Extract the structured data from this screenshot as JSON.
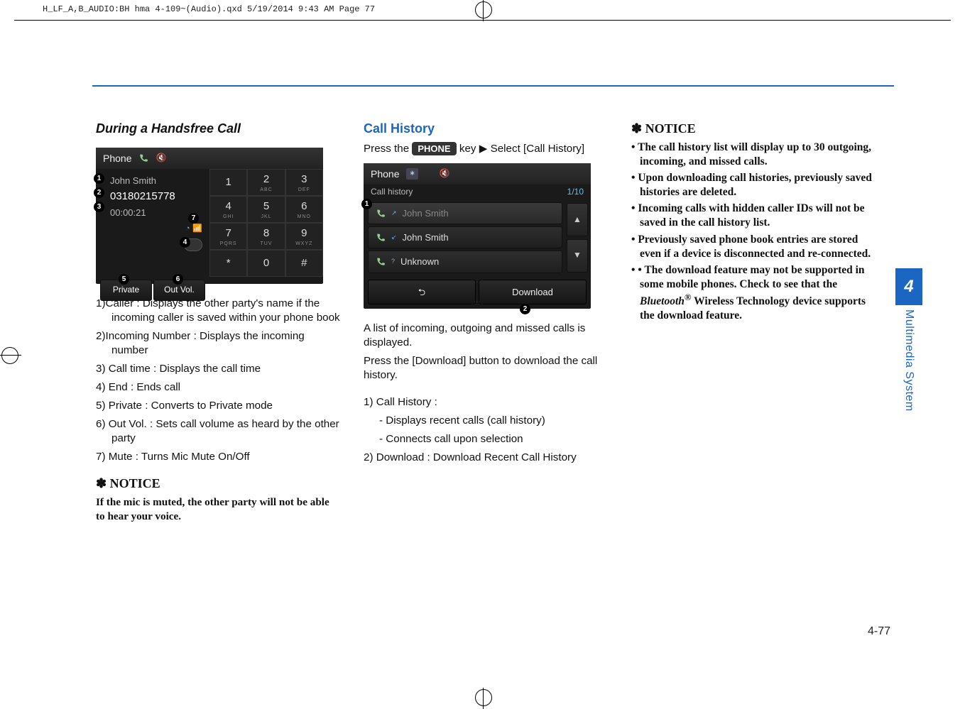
{
  "print_header": "H_LF_A,B_AUDIO:BH hma 4-109~(Audio).qxd  5/19/2014  9:43 AM  Page 77",
  "side_tab": {
    "chapter": "4",
    "label": "Multimedia System"
  },
  "page_number": "4-77",
  "col1": {
    "heading": "During a Handsfree Call",
    "ss": {
      "title": "Phone",
      "caller_name": "John Smith",
      "incoming_number": "03180215778",
      "call_time": "00:00:21",
      "btn_private": "Private",
      "btn_outvol": "Out Vol.",
      "keys": [
        {
          "n": "1",
          "s": ""
        },
        {
          "n": "2",
          "s": "ABC"
        },
        {
          "n": "3",
          "s": "DEF"
        },
        {
          "n": "4",
          "s": "GHI"
        },
        {
          "n": "5",
          "s": "JKL"
        },
        {
          "n": "6",
          "s": "MNO"
        },
        {
          "n": "7",
          "s": "PQRS"
        },
        {
          "n": "8",
          "s": "TUV"
        },
        {
          "n": "9",
          "s": "WXYZ"
        },
        {
          "n": "*",
          "s": ""
        },
        {
          "n": "0",
          "s": ""
        },
        {
          "n": "#",
          "s": ""
        }
      ]
    },
    "items": [
      "1)Caller : Displays the other party's name if the incoming caller is saved within your phone book",
      "2)Incoming Number : Displays the incoming number",
      "3) Call time : Displays the call time",
      "4) End : Ends call",
      "5) Private : Converts to Private mode",
      "6) Out Vol. : Sets call volume as heard by the other party",
      "7) Mute : Turns Mic Mute On/Off"
    ],
    "notice_h": "NOTICE",
    "notice_body": "If the mic is muted, the other party will not be able to hear your voice."
  },
  "col2": {
    "heading": "Call History",
    "intro_prefix": "Press the ",
    "intro_key": "PHONE",
    "intro_suffix": " key ▶ Select [Call History]",
    "ss": {
      "title": "Phone",
      "subtitle": "Call history",
      "counter": "1/10",
      "rows": [
        "John Smith",
        "John Smith",
        "Unknown"
      ],
      "download": "Download"
    },
    "p1": "A list of incoming, outgoing and missed calls is displayed.",
    "p2": "Press the [Download] button to download the call history.",
    "list": {
      "l1": "1) Call History :",
      "l1a": "- Displays recent calls (call history)",
      "l1b": "- Connects call upon selection",
      "l2": "2) Download : Download Recent Call History"
    }
  },
  "col3": {
    "notice_h": "NOTICE",
    "bullets": [
      "The call history list will display up to 30 outgoing, incoming, and missed calls.",
      "Upon downloading call histories, previously saved histories are deleted.",
      "Incoming calls with hidden caller IDs will not be saved in the call history list.",
      " Previously saved phone book entries are stored even if a device is disconnected and re-connected."
    ],
    "last_prefix": " The download feature may not be supported in some mobile phones. Check to see that the ",
    "bt": "Bluetooth",
    "reg": "®",
    "last_suffix": "  Wireless Technology device supports the download feature."
  }
}
